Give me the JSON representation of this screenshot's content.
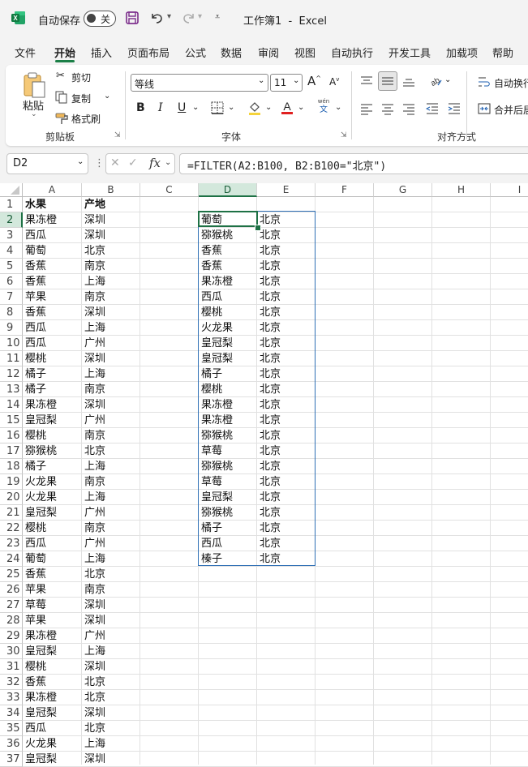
{
  "titlebar": {
    "autosave_label": "自动保存",
    "toggle_state": "关",
    "doc_title": "工作簿1  -  Excel"
  },
  "menu": [
    "文件",
    "开始",
    "插入",
    "页面布局",
    "公式",
    "数据",
    "审阅",
    "视图",
    "自动执行",
    "开发工具",
    "加载项",
    "帮助"
  ],
  "ribbon": {
    "clipboard": {
      "paste": "粘贴",
      "cut": "剪切",
      "copy": "复制",
      "format_painter": "格式刷",
      "group": "剪贴板"
    },
    "font": {
      "font_name": "等线",
      "font_size": "11",
      "group": "字体",
      "wen_top": "wén",
      "wen_bottom": "文"
    },
    "alignment": {
      "wrap_text": "自动换行",
      "merge": "合并后居",
      "group": "对齐方式"
    }
  },
  "formula_bar": {
    "name_box": "D2",
    "fx": "fx",
    "formula": "=FILTER(A2:B100, B2:B100=\"北京\")"
  },
  "columns": [
    "A",
    "B",
    "C",
    "D",
    "E",
    "F",
    "G",
    "H",
    "I"
  ],
  "rows": [
    "1",
    "2",
    "3",
    "4",
    "5",
    "6",
    "7",
    "8",
    "9",
    "10",
    "11",
    "12",
    "13",
    "14",
    "15",
    "16",
    "17",
    "18",
    "19",
    "20",
    "21",
    "22",
    "23",
    "24",
    "25",
    "26",
    "27",
    "28",
    "29",
    "30",
    "31",
    "32",
    "33",
    "34",
    "35",
    "36",
    "37"
  ],
  "sheet": {
    "header": [
      "水果",
      "产地"
    ],
    "colA": [
      "果冻橙",
      "西瓜",
      "葡萄",
      "香蕉",
      "香蕉",
      "苹果",
      "香蕉",
      "西瓜",
      "西瓜",
      "樱桃",
      "橘子",
      "橘子",
      "果冻橙",
      "皇冠梨",
      "樱桃",
      "猕猴桃",
      "橘子",
      "火龙果",
      "火龙果",
      "皇冠梨",
      "樱桃",
      "西瓜",
      "葡萄",
      "香蕉",
      "苹果",
      "草莓",
      "苹果",
      "果冻橙",
      "皇冠梨",
      "樱桃",
      "香蕉",
      "果冻橙",
      "皇冠梨",
      "西瓜",
      "火龙果",
      "皇冠梨"
    ],
    "colB": [
      "深圳",
      "深圳",
      "北京",
      "南京",
      "上海",
      "南京",
      "深圳",
      "上海",
      "广州",
      "深圳",
      "上海",
      "南京",
      "深圳",
      "广州",
      "南京",
      "北京",
      "上海",
      "南京",
      "上海",
      "广州",
      "南京",
      "广州",
      "上海",
      "北京",
      "南京",
      "深圳",
      "深圳",
      "广州",
      "上海",
      "深圳",
      "北京",
      "北京",
      "深圳",
      "北京",
      "上海",
      "深圳"
    ],
    "colD": [
      "葡萄",
      "猕猴桃",
      "香蕉",
      "香蕉",
      "果冻橙",
      "西瓜",
      "樱桃",
      "火龙果",
      "皇冠梨",
      "皇冠梨",
      "橘子",
      "樱桃",
      "果冻橙",
      "果冻橙",
      "猕猴桃",
      "草莓",
      "猕猴桃",
      "草莓",
      "皇冠梨",
      "猕猴桃",
      "橘子",
      "西瓜",
      "榛子"
    ],
    "colE": [
      "北京",
      "北京",
      "北京",
      "北京",
      "北京",
      "北京",
      "北京",
      "北京",
      "北京",
      "北京",
      "北京",
      "北京",
      "北京",
      "北京",
      "北京",
      "北京",
      "北京",
      "北京",
      "北京",
      "北京",
      "北京",
      "北京",
      "北京"
    ]
  },
  "colors": {
    "accent": "#1e7145",
    "chrome": "#f3f3f3",
    "spill_border": "#2f6fb5"
  }
}
